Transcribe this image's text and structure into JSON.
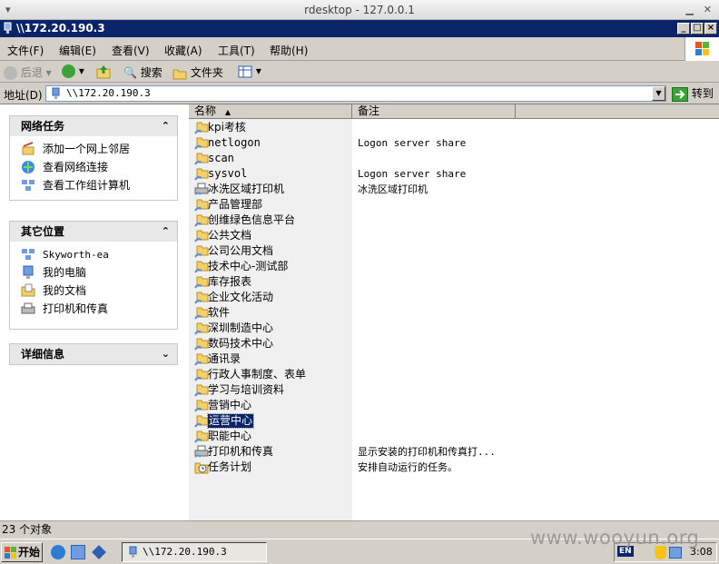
{
  "outer_window": {
    "title": "rdesktop - 127.0.0.1"
  },
  "window": {
    "title": "\\\\172.20.190.3"
  },
  "menu": {
    "items": [
      "文件(F)",
      "编辑(E)",
      "查看(V)",
      "收藏(A)",
      "工具(T)",
      "帮助(H)"
    ]
  },
  "toolbar": {
    "back_label": "后退",
    "search_label": "搜索",
    "folders_label": "文件夹"
  },
  "address": {
    "label": "地址(D)",
    "value": "\\\\172.20.190.3",
    "go_label": "转到"
  },
  "tasks_panel": {
    "title": "网络任务",
    "links": [
      "添加一个网上邻居",
      "查看网络连接",
      "查看工作组计算机"
    ]
  },
  "places_panel": {
    "title": "其它位置",
    "links": [
      "Skyworth-ea",
      "我的电脑",
      "我的文档",
      "打印机和传真"
    ]
  },
  "details_panel": {
    "title": "详细信息"
  },
  "list": {
    "columns": [
      "名称",
      "备注"
    ],
    "selected": "运营中心",
    "items": [
      {
        "name": "kpi考核",
        "note": "",
        "icon": "shared-folder-icon"
      },
      {
        "name": "netlogon",
        "note": "Logon server share",
        "icon": "shared-folder-icon"
      },
      {
        "name": "scan",
        "note": "",
        "icon": "shared-folder-icon"
      },
      {
        "name": "sysvol",
        "note": "Logon server share",
        "icon": "shared-folder-icon"
      },
      {
        "name": "冰洗区域打印机",
        "note": "冰洗区域打印机",
        "icon": "shared-printer-icon"
      },
      {
        "name": "产品管理部",
        "note": "",
        "icon": "shared-folder-icon"
      },
      {
        "name": "创维绿色信息平台",
        "note": "",
        "icon": "shared-folder-icon"
      },
      {
        "name": "公共文档",
        "note": "",
        "icon": "shared-folder-icon"
      },
      {
        "name": "公司公用文档",
        "note": "",
        "icon": "shared-folder-icon"
      },
      {
        "name": "技术中心-测试部",
        "note": "",
        "icon": "shared-folder-icon"
      },
      {
        "name": "库存报表",
        "note": "",
        "icon": "shared-folder-icon"
      },
      {
        "name": "企业文化活动",
        "note": "",
        "icon": "shared-folder-icon"
      },
      {
        "name": "软件",
        "note": "",
        "icon": "shared-folder-icon"
      },
      {
        "name": "深圳制造中心",
        "note": "",
        "icon": "shared-folder-icon"
      },
      {
        "name": "数码技术中心",
        "note": "",
        "icon": "shared-folder-icon"
      },
      {
        "name": "通讯录",
        "note": "",
        "icon": "shared-folder-icon"
      },
      {
        "name": "行政人事制度、表单",
        "note": "",
        "icon": "shared-folder-icon"
      },
      {
        "name": "学习与培训资料",
        "note": "",
        "icon": "shared-folder-icon"
      },
      {
        "name": "营销中心",
        "note": "",
        "icon": "shared-folder-icon"
      },
      {
        "name": "运营中心",
        "note": "",
        "icon": "shared-folder-icon"
      },
      {
        "name": "职能中心",
        "note": "",
        "icon": "shared-folder-icon"
      },
      {
        "name": "打印机和传真",
        "note": "显示安装的打印机和传真打...",
        "icon": "printers-faxes-icon"
      },
      {
        "name": "任务计划",
        "note": "安排自动运行的任务。",
        "icon": "scheduled-tasks-icon"
      }
    ]
  },
  "status": {
    "text": "23 个对象"
  },
  "taskbar": {
    "start_label": "开始",
    "task_label": "\\\\172.20.190.3",
    "tray_lang": "EN",
    "clock": "3:08"
  },
  "watermark": "www.wooyun.org",
  "colors": {
    "title_bar": "#0a246a",
    "selection": "#0a246a",
    "chrome": "#d4d0c8"
  }
}
